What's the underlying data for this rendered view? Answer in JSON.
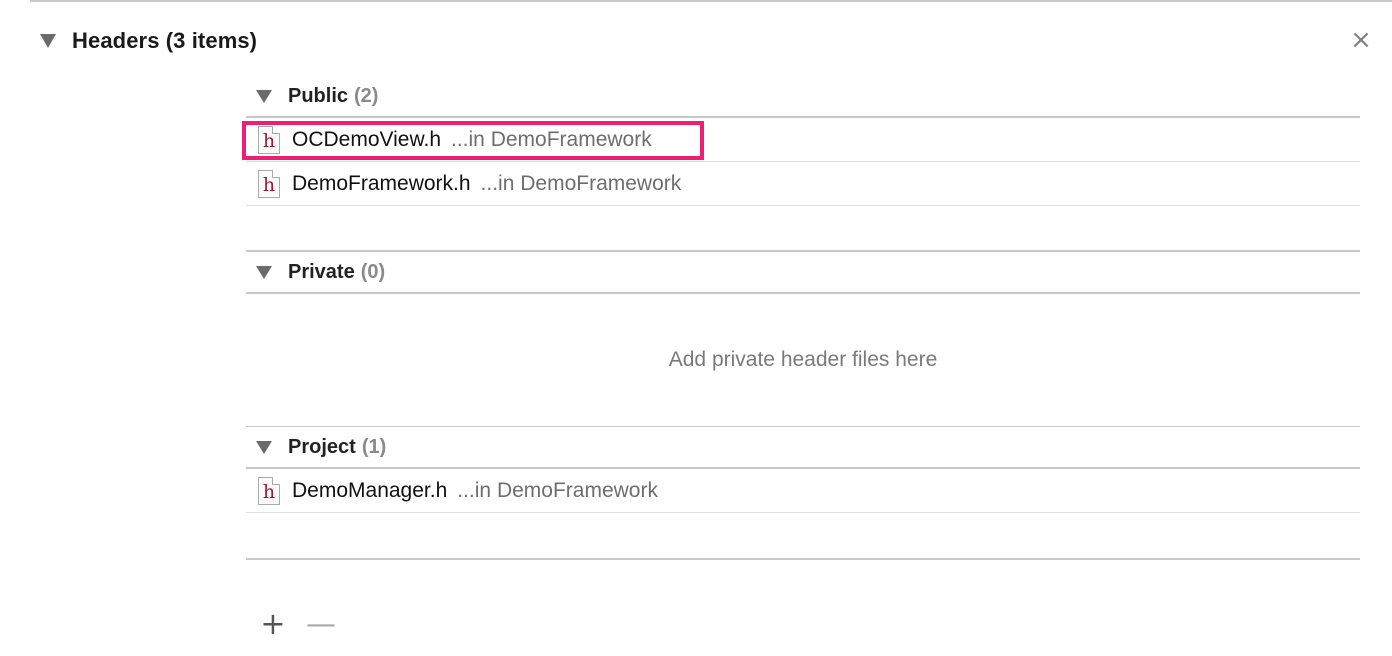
{
  "section": {
    "title": "Headers (3 items)",
    "close_glyph": "×"
  },
  "groups": {
    "public": {
      "name": "Public",
      "count": "(2)",
      "files": [
        {
          "icon_letter": "h",
          "name": "OCDemoView.h",
          "location": "...in DemoFramework"
        },
        {
          "icon_letter": "h",
          "name": "DemoFramework.h",
          "location": "...in DemoFramework"
        }
      ]
    },
    "private": {
      "name": "Private",
      "count": "(0)",
      "placeholder": "Add private header files here"
    },
    "project": {
      "name": "Project",
      "count": "(1)",
      "files": [
        {
          "icon_letter": "h",
          "name": "DemoManager.h",
          "location": "...in DemoFramework"
        }
      ]
    }
  },
  "footer": {
    "add_glyph": "+",
    "remove_glyph": "—"
  },
  "colors": {
    "highlight": "#ec1f74",
    "file_icon_letter": "#9b1c2e"
  }
}
